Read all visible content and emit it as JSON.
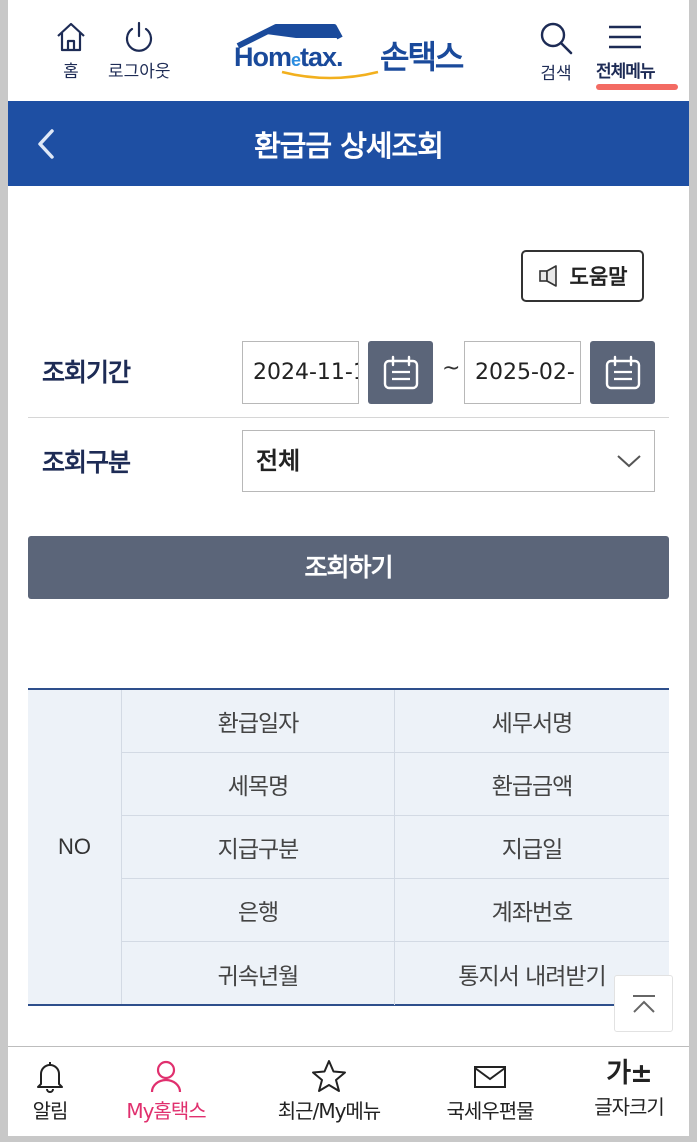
{
  "header": {
    "home_label": "홈",
    "logout_label": "로그아웃",
    "logo_text_1": "Hom",
    "logo_text_e": "e",
    "logo_text_2": "tax.",
    "logo_ko": "손택스",
    "search_label": "검색",
    "menu_label": "전체메뉴"
  },
  "title_bar": {
    "title": "환급금 상세조회"
  },
  "help": {
    "label": "도움말"
  },
  "form": {
    "period_label": "조회기간",
    "date_from": "2024-11-1",
    "date_separator": "~",
    "date_to": "2025-02-",
    "type_label": "조회구분",
    "type_selected": "전체",
    "submit_label": "조회하기"
  },
  "table": {
    "no_header": "NO",
    "rows": [
      [
        "환급일자",
        "세무서명"
      ],
      [
        "세목명",
        "환급금액"
      ],
      [
        "지급구분",
        "지급일"
      ],
      [
        "은행",
        "계좌번호"
      ],
      [
        "귀속년월",
        "통지서 내려받기"
      ]
    ]
  },
  "bottom_nav": {
    "alarm": "알림",
    "my_hometax": "My홈택스",
    "recent": "최근/My메뉴",
    "mail": "국세우편물",
    "font_size_icon": "가±",
    "font_size": "글자크기"
  },
  "colors": {
    "brand_blue": "#1e4fa3",
    "button_gray": "#5b6579",
    "active_pink": "#e0306e",
    "menu_underline": "#f36b63",
    "table_bg": "#edf2f8"
  },
  "icons": [
    "home-icon",
    "power-icon",
    "search-icon",
    "hamburger-icon",
    "back-arrow-icon",
    "speaker-icon",
    "calendar-icon",
    "chevron-down-icon",
    "scroll-top-icon",
    "bell-icon",
    "person-icon",
    "star-icon",
    "mail-icon"
  ]
}
